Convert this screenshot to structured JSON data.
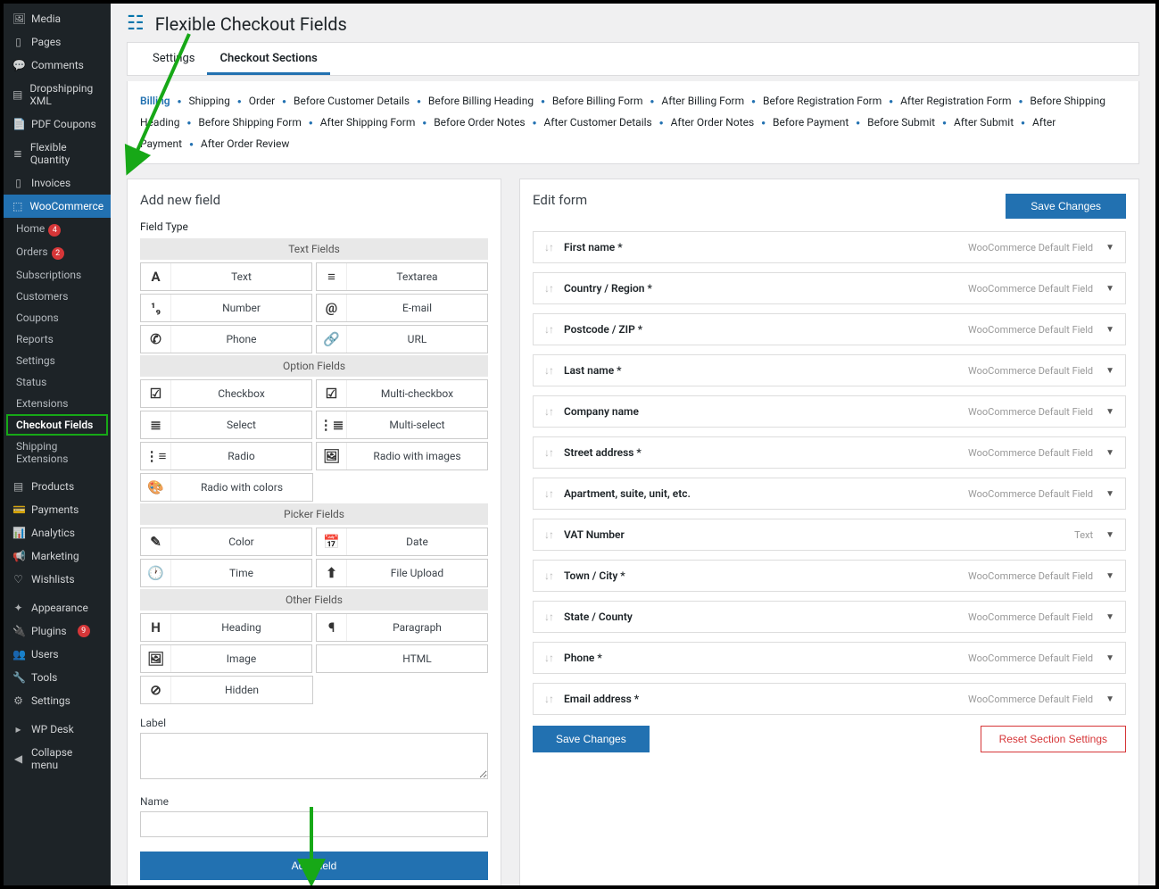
{
  "pageTitle": "Flexible Checkout Fields",
  "sidebar": {
    "top": [
      {
        "icon": "🖼",
        "label": "Media"
      },
      {
        "icon": "▯",
        "label": "Pages"
      },
      {
        "icon": "💬",
        "label": "Comments"
      },
      {
        "icon": "▤",
        "label": "Dropshipping XML"
      },
      {
        "icon": "📄",
        "label": "PDF Coupons"
      },
      {
        "icon": "≣",
        "label": "Flexible Quantity"
      },
      {
        "icon": "▯",
        "label": "Invoices"
      }
    ],
    "woo": {
      "icon": "⬚",
      "label": "WooCommerce"
    },
    "wooSub": [
      {
        "label": "Home",
        "badge": "4"
      },
      {
        "label": "Orders",
        "badge": "2"
      },
      {
        "label": "Subscriptions"
      },
      {
        "label": "Customers"
      },
      {
        "label": "Coupons"
      },
      {
        "label": "Reports"
      },
      {
        "label": "Settings"
      },
      {
        "label": "Status"
      },
      {
        "label": "Extensions"
      },
      {
        "label": "Checkout Fields",
        "curr": true,
        "box": true
      },
      {
        "label": "Shipping Extensions"
      }
    ],
    "bottom": [
      {
        "icon": "▤",
        "label": "Products"
      },
      {
        "icon": "💳",
        "label": "Payments"
      },
      {
        "icon": "📊",
        "label": "Analytics"
      },
      {
        "icon": "📢",
        "label": "Marketing"
      },
      {
        "icon": "♡",
        "label": "Wishlists"
      }
    ],
    "bottom2": [
      {
        "icon": "✦",
        "label": "Appearance"
      },
      {
        "icon": "🔌",
        "label": "Plugins",
        "badge": "9"
      },
      {
        "icon": "👥",
        "label": "Users"
      },
      {
        "icon": "🔧",
        "label": "Tools"
      },
      {
        "icon": "⚙",
        "label": "Settings"
      }
    ],
    "bottom3": [
      {
        "icon": "▸",
        "label": "WP Desk"
      },
      {
        "icon": "◀",
        "label": "Collapse menu"
      }
    ]
  },
  "tabs": [
    {
      "label": "Settings"
    },
    {
      "label": "Checkout Sections",
      "active": true
    }
  ],
  "subtabs": [
    "Billing",
    "Shipping",
    "Order",
    "Before Customer Details",
    "Before Billing Heading",
    "Before Billing Form",
    "After Billing Form",
    "Before Registration Form",
    "After Registration Form",
    "Before Shipping Heading",
    "Before Shipping Form",
    "After Shipping Form",
    "Before Order Notes",
    "After Customer Details",
    "After Order Notes",
    "Before Payment",
    "Before Submit",
    "After Submit",
    "After Payment",
    "After Order Review"
  ],
  "subtabActive": 0,
  "addNew": {
    "title": "Add new field",
    "fieldTypeLabel": "Field Type",
    "groups": [
      {
        "title": "Text Fields",
        "items": [
          {
            "icon": "A",
            "label": "Text"
          },
          {
            "icon": "≡",
            "label": "Textarea"
          },
          {
            "icon": "¹₉",
            "label": "Number"
          },
          {
            "icon": "@",
            "label": "E-mail"
          },
          {
            "icon": "✆",
            "label": "Phone"
          },
          {
            "icon": "🔗",
            "label": "URL"
          }
        ]
      },
      {
        "title": "Option Fields",
        "items": [
          {
            "icon": "☑",
            "label": "Checkbox"
          },
          {
            "icon": "☑",
            "label": "Multi-checkbox"
          },
          {
            "icon": "≣",
            "label": "Select"
          },
          {
            "icon": "⋮≣",
            "label": "Multi-select"
          },
          {
            "icon": "⋮≡",
            "label": "Radio"
          },
          {
            "icon": "🖼",
            "label": "Radio with images"
          },
          {
            "icon": "🎨",
            "label": "Radio with colors"
          }
        ]
      },
      {
        "title": "Picker Fields",
        "items": [
          {
            "icon": "✎",
            "label": "Color"
          },
          {
            "icon": "📅",
            "label": "Date"
          },
          {
            "icon": "🕐",
            "label": "Time"
          },
          {
            "icon": "⬆",
            "label": "File Upload"
          }
        ]
      },
      {
        "title": "Other Fields",
        "items": [
          {
            "icon": "H",
            "label": "Heading"
          },
          {
            "icon": "¶",
            "label": "Paragraph"
          },
          {
            "icon": "🖼",
            "label": "Image"
          },
          {
            "icon": "</>",
            "label": "HTML"
          },
          {
            "icon": "⊘",
            "label": "Hidden"
          }
        ]
      }
    ],
    "labelLabel": "Label",
    "nameLabel": "Name",
    "addBtn": "Add Field"
  },
  "editForm": {
    "title": "Edit form",
    "saveTop": "Save Changes",
    "saveBottom": "Save Changes",
    "reset": "Reset Section Settings",
    "fields": [
      {
        "name": "First name *",
        "type": "WooCommerce Default Field"
      },
      {
        "name": "Country / Region *",
        "type": "WooCommerce Default Field"
      },
      {
        "name": "Postcode / ZIP *",
        "type": "WooCommerce Default Field"
      },
      {
        "name": "Last name *",
        "type": "WooCommerce Default Field"
      },
      {
        "name": "Company name",
        "type": "WooCommerce Default Field"
      },
      {
        "name": "Street address *",
        "type": "WooCommerce Default Field"
      },
      {
        "name": "Apartment, suite, unit, etc.",
        "type": "WooCommerce Default Field"
      },
      {
        "name": "VAT Number",
        "type": "Text"
      },
      {
        "name": "Town / City *",
        "type": "WooCommerce Default Field"
      },
      {
        "name": "State / County",
        "type": "WooCommerce Default Field"
      },
      {
        "name": "Phone *",
        "type": "WooCommerce Default Field"
      },
      {
        "name": "Email address *",
        "type": "WooCommerce Default Field"
      }
    ]
  }
}
